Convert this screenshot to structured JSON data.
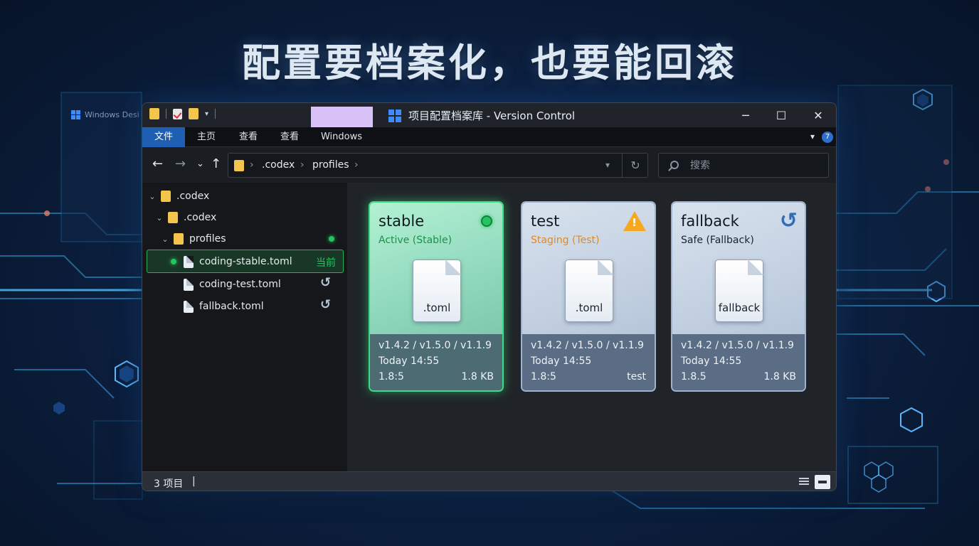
{
  "headline": "配置要档案化，也要能回滚",
  "background_window_label": "Windows Desi",
  "window": {
    "title": "项目配置档案库 - Version Control",
    "controls": {
      "minimize": "─",
      "maximize": "☐",
      "close": "✕"
    }
  },
  "ribbon": {
    "tabs": [
      "文件",
      "主页",
      "查看",
      "查看",
      "Windows"
    ],
    "active_tab": "文件",
    "help_badge": "7"
  },
  "nav": {
    "back": "←",
    "forward": "→",
    "recent": "⌄",
    "up": "↑",
    "breadcrumb": [
      ".codex",
      "profiles"
    ],
    "search_placeholder": "搜索"
  },
  "tree": {
    "items": [
      {
        "label": ".codex",
        "type": "folder"
      },
      {
        "label": ".codex",
        "type": "folder"
      },
      {
        "label": "profiles",
        "type": "folder"
      },
      {
        "label": "coding-stable.toml",
        "type": "file",
        "tag": "当前"
      },
      {
        "label": "coding-test.toml",
        "type": "file"
      },
      {
        "label": "fallback.toml",
        "type": "file"
      }
    ]
  },
  "cards": [
    {
      "name": "stable",
      "status": "Active (Stable)",
      "status_color": "#1f8f4a",
      "icon": "green-dot-icon",
      "file_label": ".toml",
      "versions": "v1.4.2 / v1.5.0 / v1.1.9",
      "time": "Today 14:55",
      "bottom_left": "1.8:5",
      "bottom_right": "1.8 KB"
    },
    {
      "name": "test",
      "status": "Staging (Test)",
      "status_color": "#e08a1e",
      "icon": "warning-icon",
      "file_label": ".toml",
      "versions": "v1.4.2 / v1.5.0 / v1.1.9",
      "time": "Today 14:55",
      "bottom_left": "1.8:5",
      "bottom_right": "test"
    },
    {
      "name": "fallback",
      "status": "Safe (Fallback)",
      "status_color": "#1a232e",
      "icon": "revert-icon",
      "file_label": "fallback",
      "versions": "v1.4.2 / v1.5.0 / v1.1.9",
      "time": "Today 14:55",
      "bottom_left": "1.8.5",
      "bottom_right": "1.8 KB"
    }
  ],
  "statusbar": {
    "count": "3 项目",
    "caret": "|"
  },
  "colors": {
    "accent": "#1f5fb3",
    "active_green": "#22c55e",
    "warning": "#f6a821"
  }
}
